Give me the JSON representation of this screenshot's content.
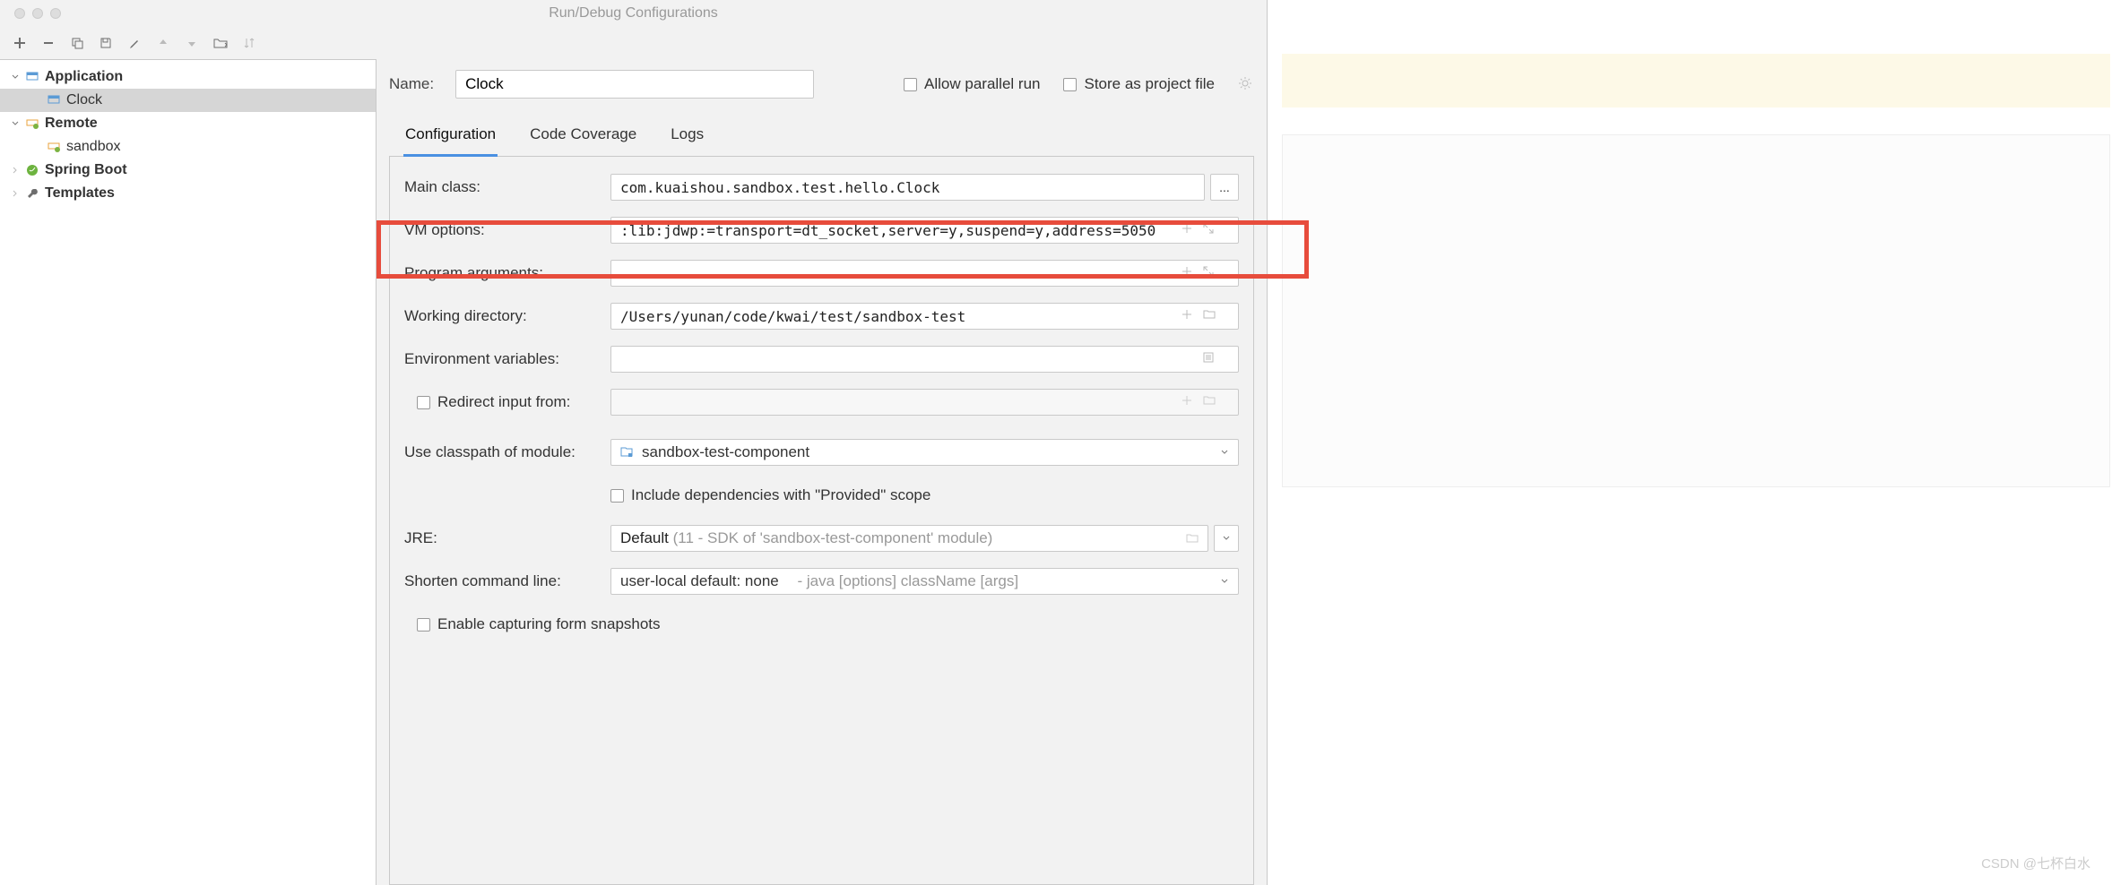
{
  "window": {
    "title": "Run/Debug Configurations"
  },
  "nameRow": {
    "label": "Name:",
    "value": "Clock",
    "allowParallel": "Allow parallel run",
    "storeAsProject": "Store as project file"
  },
  "toolbarIcons": [
    "add",
    "remove",
    "copy",
    "save",
    "wrench",
    "up",
    "down",
    "folder-move",
    "sort"
  ],
  "tree": {
    "items": [
      {
        "label": "Application",
        "bold": true,
        "icon": "app",
        "expanded": true,
        "children": [
          {
            "label": "Clock",
            "selected": true,
            "icon": "app"
          }
        ]
      },
      {
        "label": "Remote",
        "bold": true,
        "icon": "remote",
        "expanded": true,
        "children": [
          {
            "label": "sandbox",
            "icon": "remote"
          }
        ]
      },
      {
        "label": "Spring Boot",
        "bold": true,
        "icon": "spring",
        "expanded": false
      },
      {
        "label": "Templates",
        "bold": true,
        "icon": "wrench",
        "expanded": false
      }
    ]
  },
  "tabs": {
    "items": [
      "Configuration",
      "Code Coverage",
      "Logs"
    ],
    "activeIndex": 0
  },
  "form": {
    "mainClass": {
      "label": "Main class:",
      "value": "com.kuaishou.sandbox.test.hello.Clock"
    },
    "vmOptions": {
      "label": "VM options:",
      "value": ":lib:jdwp:=transport=dt_socket,server=y,suspend=y,address=5050"
    },
    "programArgs": {
      "label": "Program arguments:",
      "value": ""
    },
    "workingDir": {
      "label": "Working directory:",
      "value": "/Users/yunan/code/kwai/test/sandbox-test"
    },
    "envVars": {
      "label": "Environment variables:",
      "value": ""
    },
    "redirectInput": {
      "label": "Redirect input from:",
      "value": ""
    },
    "classpathModule": {
      "label": "Use classpath of module:",
      "value": "sandbox-test-component"
    },
    "includeProvided": {
      "label": "Include dependencies with \"Provided\" scope"
    },
    "jre": {
      "label": "JRE:",
      "value": "Default",
      "hint": "(11 - SDK of 'sandbox-test-component' module)"
    },
    "shortenCmd": {
      "label": "Shorten command line:",
      "value": "user-local default: none",
      "hint": "- java [options] className [args]"
    },
    "enableCapture": {
      "label": "Enable capturing form snapshots"
    }
  },
  "watermark": "CSDN @七杯白水"
}
